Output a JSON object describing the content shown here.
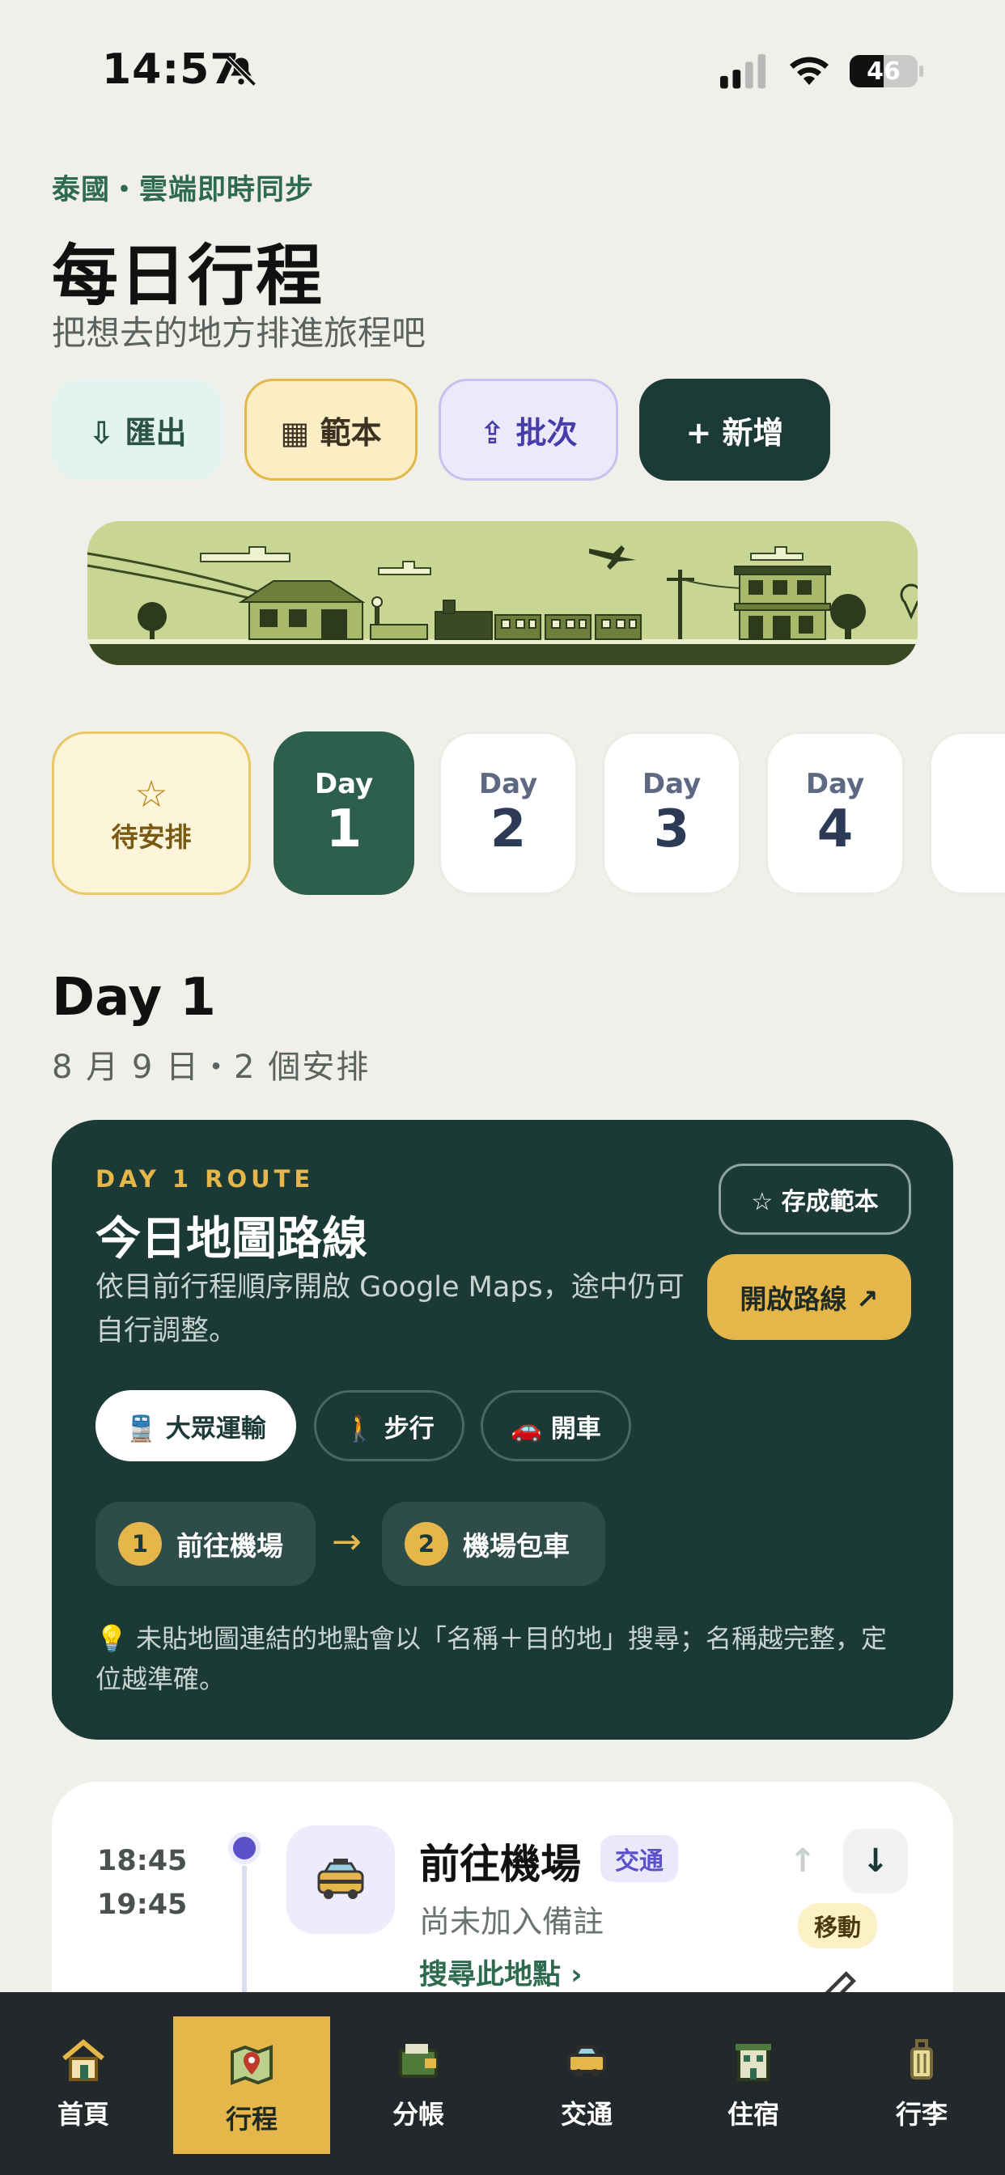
{
  "status_bar": {
    "time": "14:57",
    "battery": "46"
  },
  "header": {
    "kicker": "泰國・雲端即時同步",
    "title": "每日行程",
    "subtitle": "把想去的地方排進旅程吧"
  },
  "actions": {
    "export_label": "⇩ 匯出",
    "template_label": "▦ 範本",
    "batch_label": "⇪ 批次",
    "add_label": "+ 新增"
  },
  "day_tabs": {
    "pending_label": "待安排",
    "pending_icon": "star-icon",
    "day_label": "Day",
    "days": [
      "1",
      "2",
      "3",
      "4"
    ],
    "selected": "1"
  },
  "day_section": {
    "heading": "Day 1",
    "meta": "8 月 9 日・2 個安排"
  },
  "route_card": {
    "kicker": "DAY 1 ROUTE",
    "title": "今日地圖路線",
    "description": "依目前行程順序開啟 Google Maps，途中仍可自行調整。",
    "save_template": "☆ 存成範本",
    "open_route": "開啟路線 ↗",
    "modes": {
      "transit": "🚆 大眾運輸",
      "walk": "🚶 步行",
      "drive": "🚗 開車"
    },
    "selected_mode": "transit",
    "stops": [
      {
        "n": "1",
        "name": "前往機場"
      },
      {
        "n": "2",
        "name": "機場包車"
      }
    ],
    "hint": "💡 未貼地圖連結的地點會以「名稱＋目的地」搜尋；名稱越完整，定位越準確。"
  },
  "item": {
    "time_start": "18:45",
    "time_end": "19:45",
    "icon": "taxi-icon",
    "title": "前往機場",
    "badge": "交通",
    "note": "尚未加入備註",
    "link": "搜尋此地點 ›",
    "move_tag": "移動"
  },
  "tabbar": {
    "items": [
      {
        "label": "首頁",
        "icon": "house-icon"
      },
      {
        "label": "行程",
        "icon": "map-icon"
      },
      {
        "label": "分帳",
        "icon": "wallet-icon"
      },
      {
        "label": "交通",
        "icon": "taxi-icon"
      },
      {
        "label": "住宿",
        "icon": "hotel-icon"
      },
      {
        "label": "行李",
        "icon": "luggage-icon"
      }
    ],
    "active": "行程"
  },
  "colors": {
    "accent": "#e5b64a",
    "dark_green": "#1b3a35",
    "selected_day": "#2e5e4c",
    "purple": "#5b51c9"
  }
}
